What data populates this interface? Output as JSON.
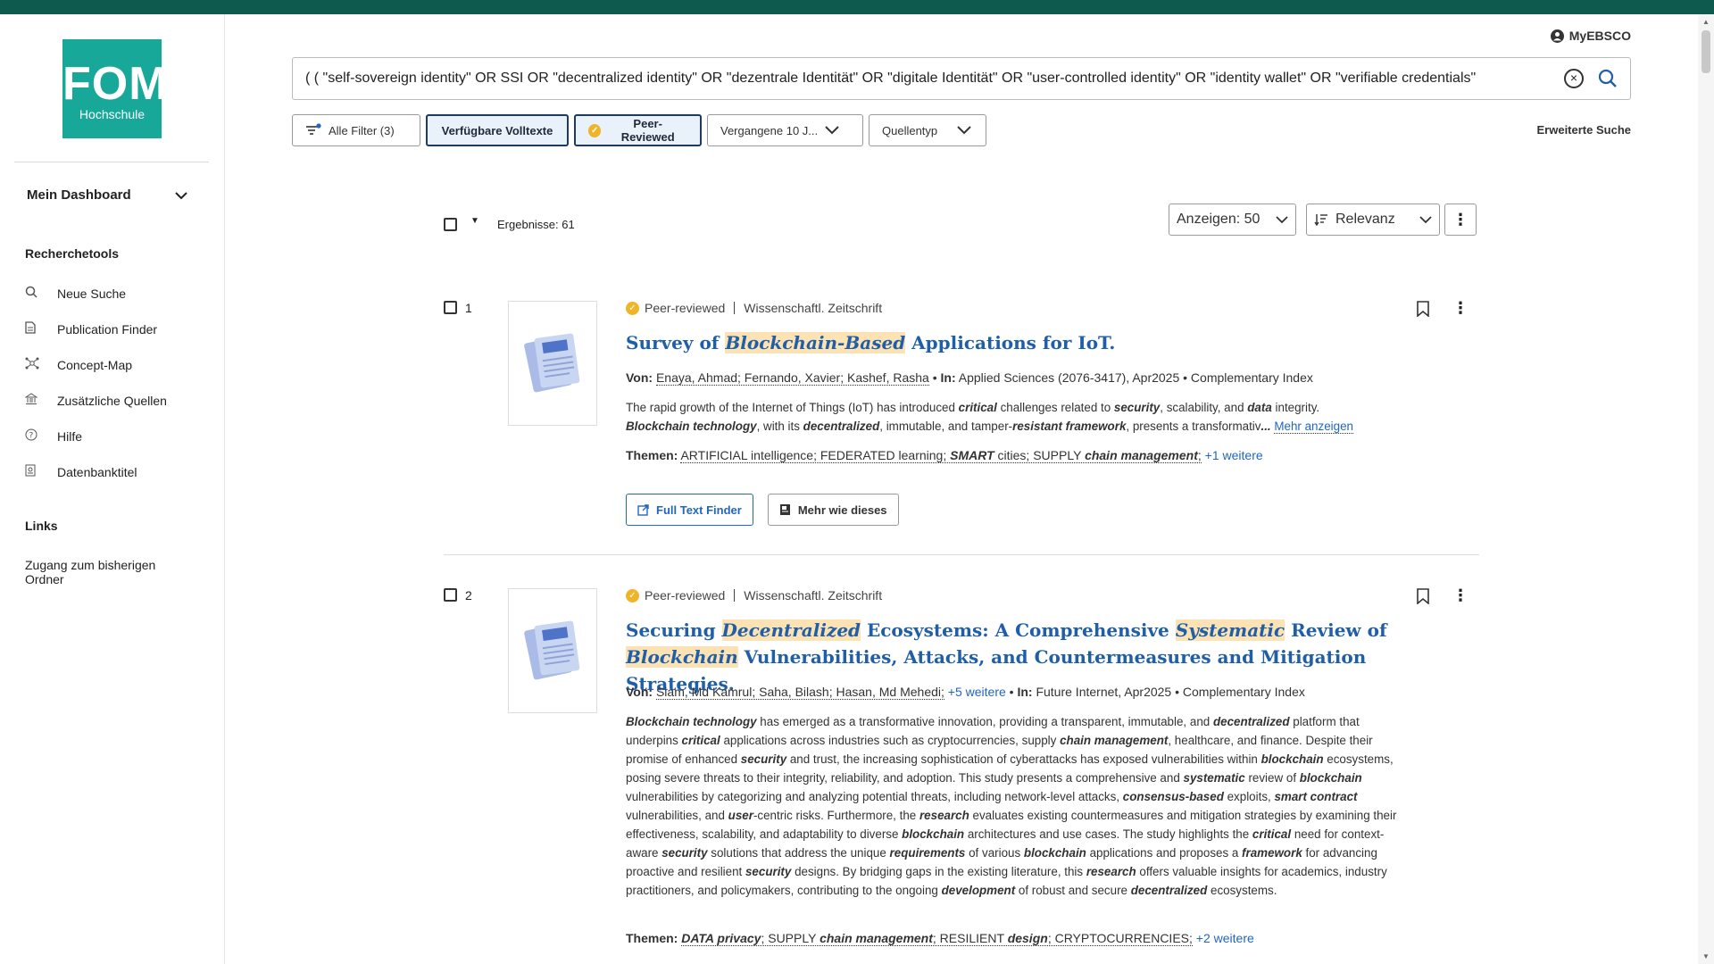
{
  "brand": {
    "logo_text": "FOM",
    "logo_sub": "Hochschule"
  },
  "sidebar": {
    "dashboard": "Mein Dashboard",
    "tools_heading": "Recherchetools",
    "items": [
      {
        "label": "Neue Suche",
        "icon": "search-icon"
      },
      {
        "label": "Publication Finder",
        "icon": "document-icon"
      },
      {
        "label": "Concept-Map",
        "icon": "network-icon"
      },
      {
        "label": "Zusätzliche Quellen",
        "icon": "bank-icon"
      },
      {
        "label": "Hilfe",
        "icon": "help-icon"
      },
      {
        "label": "Datenbanktitel",
        "icon": "database-icon"
      }
    ],
    "links_heading": "Links",
    "link": "Zugang zum bisherigen Ordner"
  },
  "header": {
    "myebsco": "MyEBSCO",
    "search_value": "( ( \"self-sovereign identity\" OR SSI OR \"decentralized identity\" OR \"dezentrale Identität\" OR \"digitale Identität\" OR \"user-controlled identity\" OR \"identity wallet\" OR \"verifiable credentials\"",
    "advanced": "Erweiterte Suche"
  },
  "filters": {
    "all": "Alle Filter (3)",
    "fulltext": "Verfügbare Volltexte",
    "peer": "Peer-Reviewed",
    "date": "Vergangene 10 J...",
    "source": "Quellentyp"
  },
  "results_bar": {
    "count": "Ergebnisse: 61",
    "show": "Anzeigen: 50",
    "sort": "Relevanz"
  },
  "results": [
    {
      "num": "1",
      "peer": "Peer-reviewed",
      "type": "Wissenschaftl. Zeitschrift",
      "by_label": "Von:",
      "authors": "Enaya, Ahmad; Fernando, Xavier; Kashef, Rasha",
      "in_label": "In:",
      "source": "Applied Sciences (2076-3417), Apr2025 • Complementary Index",
      "more": "Mehr anzeigen",
      "themes_label": "Themen:",
      "more_themes": "+1 weitere",
      "btn_fulltext": "Full Text Finder",
      "btn_similar": "Mehr wie dieses"
    },
    {
      "num": "2",
      "peer": "Peer-reviewed",
      "type": "Wissenschaftl. Zeitschrift",
      "by_label": "Von:",
      "authors": "Siam, Md Kamrul; Saha, Bilash; Hasan, Md Mehedi;",
      "more_authors": "+5 weitere",
      "in_label": "In:",
      "source": "Future Internet, Apr2025 • Complementary Index",
      "themes_label": "Themen:",
      "more_themes": "+2 weitere"
    }
  ],
  "colors": {
    "topbar": "#0e5a4f",
    "logo": "#18a89a",
    "link": "#2166c2",
    "highlight": "#fde3b4"
  }
}
